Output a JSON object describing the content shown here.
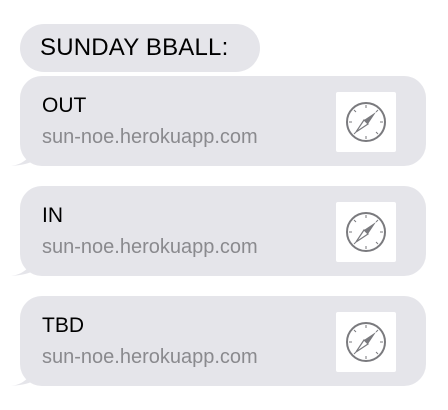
{
  "header": {
    "text": "SUNDAY BBALL:"
  },
  "links": [
    {
      "title": "OUT",
      "url": "sun-noe.herokuapp.com",
      "icon": "compass-icon"
    },
    {
      "title": "IN",
      "url": "sun-noe.herokuapp.com",
      "icon": "compass-icon"
    },
    {
      "title": "TBD",
      "url": "sun-noe.herokuapp.com",
      "icon": "compass-icon"
    }
  ],
  "colors": {
    "bubble": "#e5e5ea",
    "url_text": "#8a8a8e",
    "icon": "#7a7a7e"
  }
}
